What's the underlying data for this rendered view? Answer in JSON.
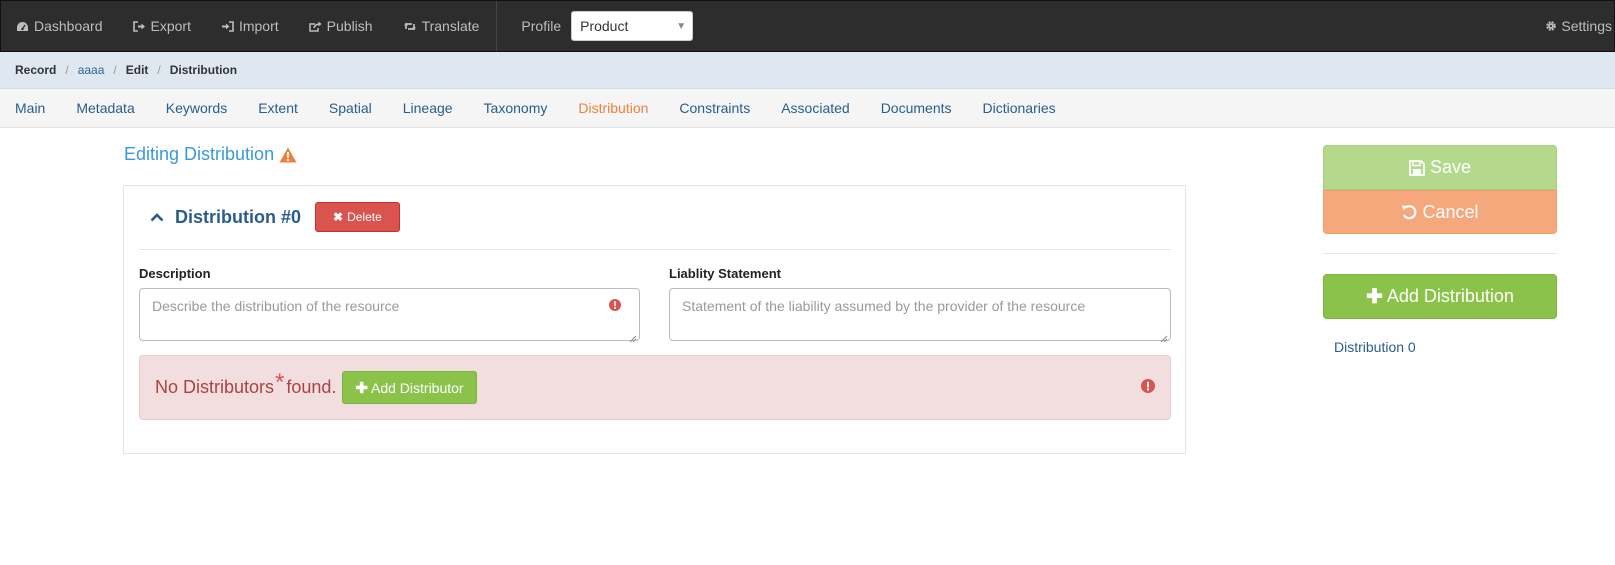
{
  "navbar": {
    "items": [
      {
        "label": "Dashboard",
        "icon": "dashboard-icon"
      },
      {
        "label": "Export",
        "icon": "sign-out-icon"
      },
      {
        "label": "Import",
        "icon": "sign-in-icon"
      },
      {
        "label": "Publish",
        "icon": "share-icon"
      },
      {
        "label": "Translate",
        "icon": "retweet-icon"
      }
    ],
    "profile_label": "Profile",
    "profile_value": "Product",
    "settings_label": "Settings"
  },
  "breadcrumb": {
    "items": [
      "Record",
      "aaaa",
      "Edit",
      "Distribution"
    ]
  },
  "tabs": [
    "Main",
    "Metadata",
    "Keywords",
    "Extent",
    "Spatial",
    "Lineage",
    "Taxonomy",
    "Distribution",
    "Constraints",
    "Associated",
    "Documents",
    "Dictionaries"
  ],
  "active_tab": "Distribution",
  "page": {
    "title": "Editing Distribution"
  },
  "distribution": {
    "title": "Distribution #0",
    "delete_label": "Delete",
    "description_label": "Description",
    "description_placeholder": "Describe the distribution of the resource",
    "liability_label": "Liablity Statement",
    "liability_placeholder": "Statement of the liability assumed by the provider of the resource",
    "alert_prefix": "No Distributors",
    "alert_asterisk": "*",
    "alert_suffix": "found.",
    "add_distributor_label": "Add Distributor"
  },
  "sidebar": {
    "save_label": "Save",
    "cancel_label": "Cancel",
    "add_distribution_label": "Add Distribution",
    "distribution_link": "Distribution 0"
  },
  "colors": {
    "accent_orange": "#f0803c",
    "link_blue": "#2a5d8c",
    "danger": "#d9534f",
    "success": "#8bc34a"
  }
}
